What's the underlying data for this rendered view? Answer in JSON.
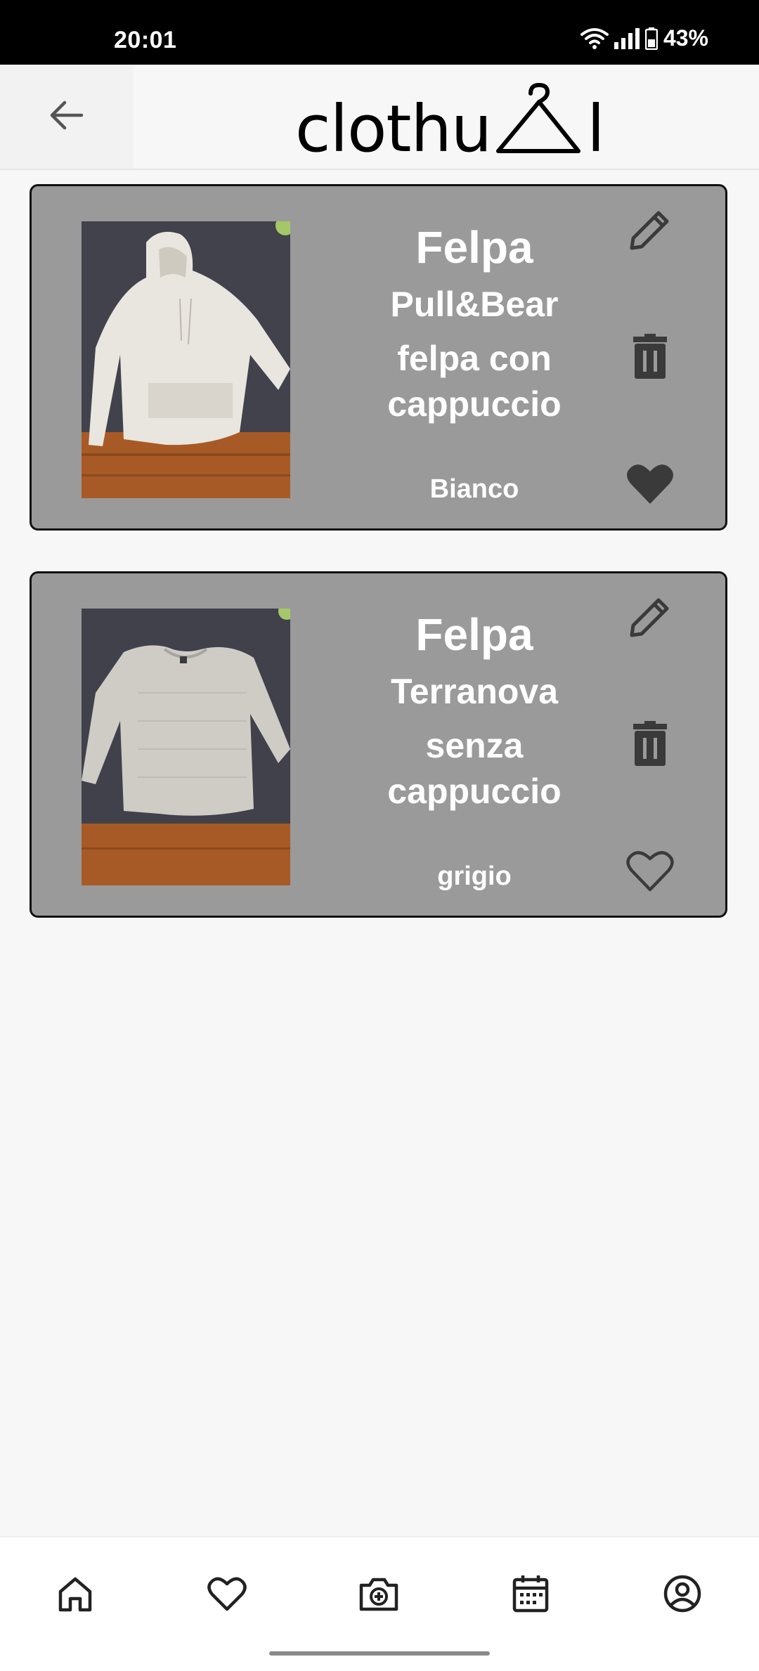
{
  "status_bar": {
    "time": "20:01",
    "battery": "43%"
  },
  "header": {
    "logo_text": "clothu",
    "logo_suffix": "l"
  },
  "items": [
    {
      "type": "Felpa",
      "description_line1": "Pull&Bear",
      "description_line2": "felpa con",
      "description_line3": "cappuccio",
      "color": "Bianco",
      "favorite": true
    },
    {
      "type": "Felpa",
      "description_line1": "Terranova",
      "description_line2": "senza",
      "description_line3": "cappuccio",
      "color": "grigio",
      "favorite": false
    }
  ],
  "nav": {
    "items": [
      "home-icon",
      "heart-icon",
      "camera-add-icon",
      "calendar-icon",
      "profile-icon"
    ]
  },
  "colors": {
    "card_bg": "#9a9a9a",
    "icon_dark": "#3a3a3a"
  }
}
